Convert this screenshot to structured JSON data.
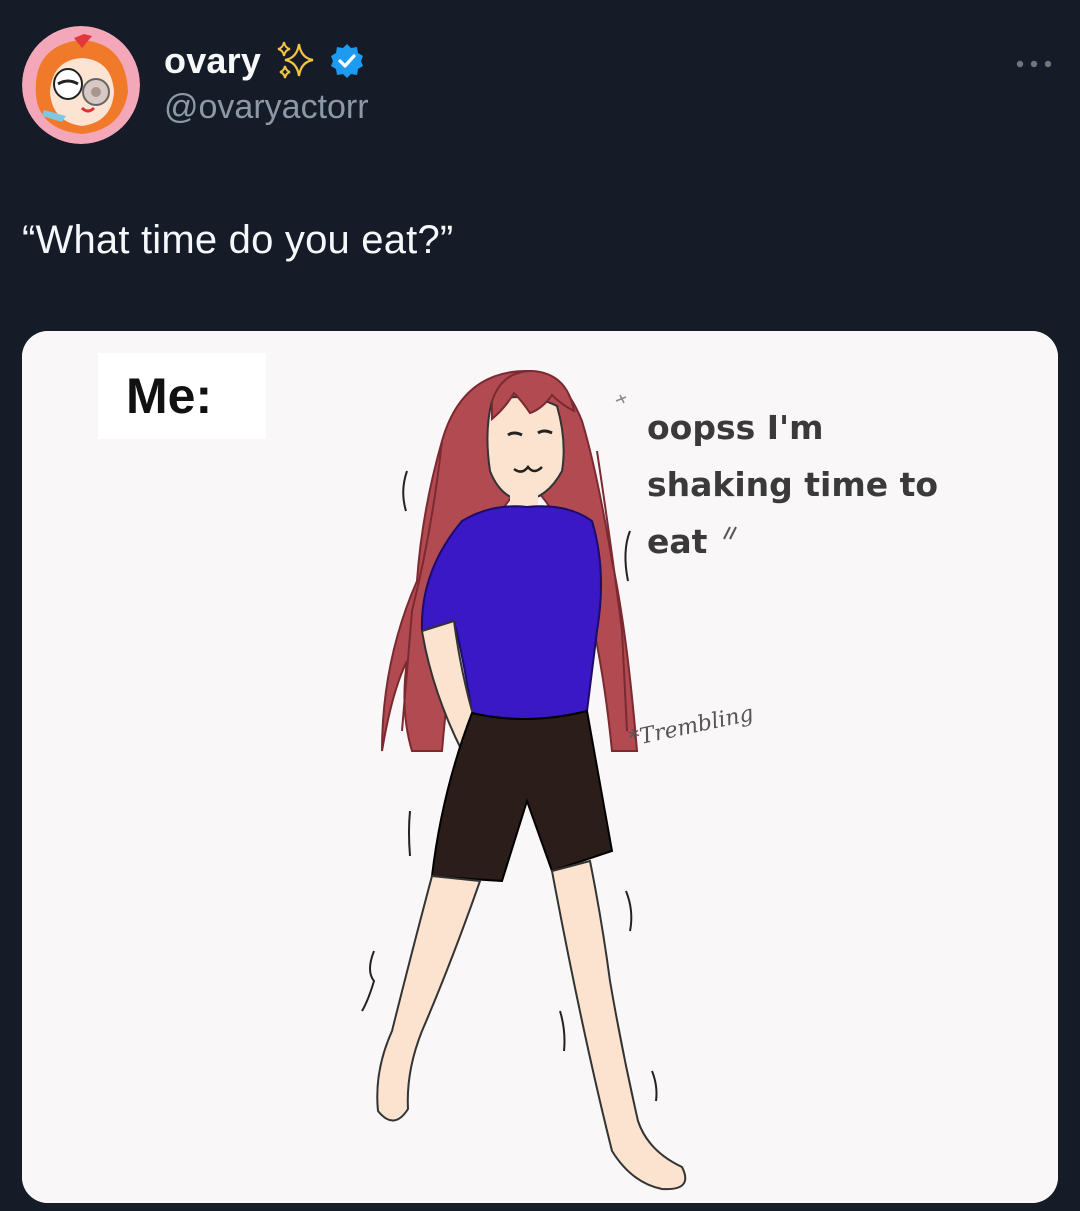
{
  "author": {
    "display_name": "ovary",
    "handle": "@ovaryactorr",
    "verified": true,
    "avatar_icon": "powerpuff-blossom-avatar",
    "name_emoji_icon": "sparkles-icon"
  },
  "tweet": {
    "text": "“What time do you eat?”"
  },
  "meme": {
    "me_label": "Me:",
    "speech_lines": [
      "oopss I'm",
      "shaking time to",
      "eat"
    ],
    "sound_effect": "*Trembling"
  },
  "icons": {
    "more": "more-horizontal-icon",
    "verified": "verified-badge-icon"
  },
  "colors": {
    "background": "#151c27",
    "verified_blue": "#1d9bf0",
    "handle_gray": "#8b98a5",
    "sparkle_gold": "#f4c542"
  }
}
